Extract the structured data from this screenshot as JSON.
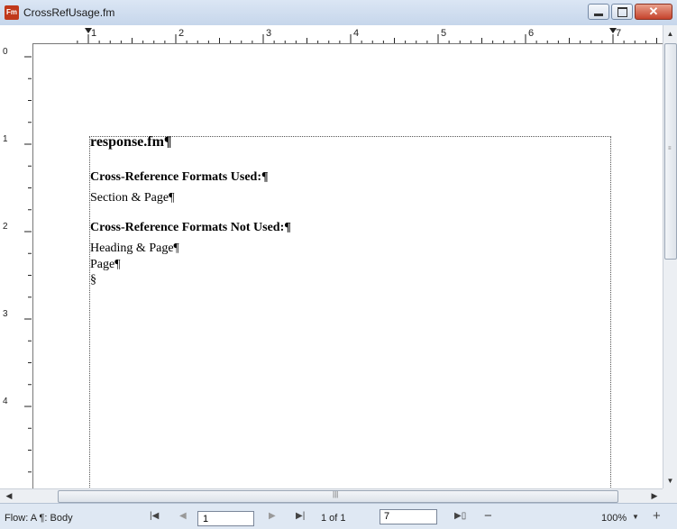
{
  "window": {
    "title": "CrossRefUsage.fm",
    "app_icon_text": "Fm"
  },
  "ruler": {
    "horizontal_numbers": [
      "1",
      "2",
      "3",
      "4",
      "5",
      "6",
      "7"
    ],
    "vertical_numbers": [
      "0",
      "1",
      "2",
      "3",
      "4"
    ]
  },
  "document": {
    "heading": "response.fm¶",
    "used_heading": "Cross-Reference Formats Used:¶",
    "used_items": [
      "Section & Page¶"
    ],
    "not_used_heading": "Cross-Reference Formats Not Used:¶",
    "not_used_items": [
      "Heading & Page¶",
      "Page¶"
    ],
    "end_marker": "§"
  },
  "status": {
    "flow": "Flow: A  ¶: Body",
    "page_input": "1",
    "page_count": "1 of 1",
    "goto_input": "7",
    "zoom": "100%"
  },
  "icons": {
    "minimize": "minimize-icon",
    "maximize": "maximize-icon",
    "close": "close-icon",
    "first_page": "first-page-icon",
    "prev_page": "prev-page-icon",
    "next_page": "next-page-icon",
    "last_page": "last-page-icon",
    "goto_page": "goto-page-icon",
    "zoom_out": "zoom-out-icon",
    "zoom_in": "zoom-in-icon"
  }
}
